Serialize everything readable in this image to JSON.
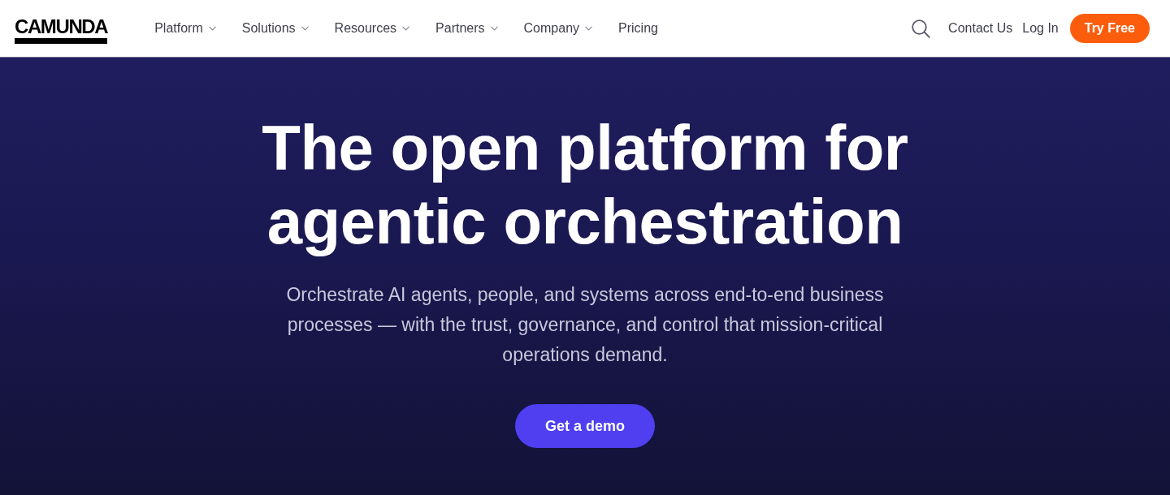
{
  "header": {
    "logo": "CAMUNDA",
    "nav": [
      {
        "label": "Platform",
        "kind": "dropdown"
      },
      {
        "label": "Solutions",
        "kind": "dropdown"
      },
      {
        "label": "Resources",
        "kind": "dropdown"
      },
      {
        "label": "Partners",
        "kind": "dropdown"
      },
      {
        "label": "Company",
        "kind": "dropdown"
      },
      {
        "label": "Pricing",
        "kind": "link"
      }
    ],
    "actions": [
      {
        "label": "Contact Us",
        "kind": "link"
      },
      {
        "label": "Log In",
        "kind": "link"
      },
      {
        "label": "Try Free",
        "kind": "button"
      }
    ]
  },
  "hero": {
    "title_lines": [
      "The open platform for",
      "agentic orchestration"
    ],
    "subtitle": "Orchestrate AI agents, people, and systems across end-to-end business processes — with the trust, governance, and control that mission-critical operations demand.",
    "cta": "Get a demo"
  }
}
